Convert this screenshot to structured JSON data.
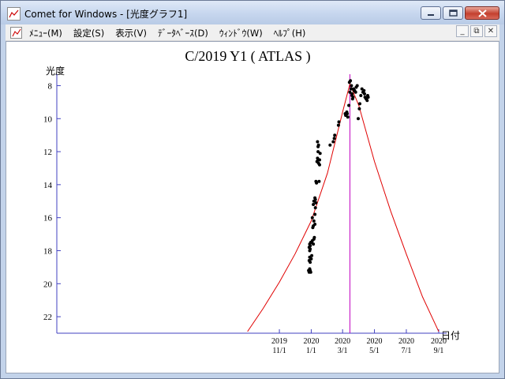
{
  "window": {
    "title": "Comet for Windows - [光度グラフ1]"
  },
  "menu": [
    {
      "label": "ﾒﾆｭｰ(M)"
    },
    {
      "label": "設定(S)"
    },
    {
      "label": "表示(V)"
    },
    {
      "label": "ﾃﾞｰﾀﾍﾞｰｽ(D)"
    },
    {
      "label": "ｳｨﾝﾄﾞｳ(W)"
    },
    {
      "label": "ﾍﾙﾌﾟ(H)"
    }
  ],
  "colors": {
    "curve": "#e00000",
    "marker": "#c000c0",
    "points": "#000000"
  },
  "chart_data": {
    "type": "scatter",
    "title": "C/2019 Y1 ( ATLAS )",
    "ylabel": "光度",
    "xlabel": "日付",
    "ylim": [
      23,
      7.5
    ],
    "yticks": [
      8,
      10,
      12,
      14,
      16,
      18,
      20,
      22
    ],
    "xlim": [
      "2018-09-01",
      "2020-09-01"
    ],
    "xticks": [
      {
        "date": "2019-11-01",
        "year": "2019",
        "md": "11/1"
      },
      {
        "date": "2020-01-01",
        "year": "2020",
        "md": "1/1"
      },
      {
        "date": "2020-03-01",
        "year": "2020",
        "md": "3/1"
      },
      {
        "date": "2020-05-01",
        "year": "2020",
        "md": "5/1"
      },
      {
        "date": "2020-07-01",
        "year": "2020",
        "md": "7/1"
      },
      {
        "date": "2020-09-01",
        "year": "2020",
        "md": "9/1"
      }
    ],
    "perihelion_date": "2020-03-15",
    "curve": {
      "type": "line",
      "x": [
        "2019-09-01",
        "2019-10-01",
        "2019-11-01",
        "2019-12-01",
        "2020-01-01",
        "2020-02-01",
        "2020-03-01",
        "2020-03-15",
        "2020-04-01",
        "2020-05-01",
        "2020-06-01",
        "2020-07-01",
        "2020-08-01",
        "2020-09-01"
      ],
      "y": [
        22.9,
        21.5,
        19.9,
        18.2,
        16.2,
        13.3,
        9.6,
        7.9,
        9.2,
        12.6,
        15.6,
        18.2,
        20.8,
        22.9
      ]
    },
    "series": [
      {
        "x": [
          "2019-12-27",
          "2019-12-28",
          "2019-12-29",
          "2019-12-30",
          "2019-12-31",
          "2019-12-28",
          "2019-12-29",
          "2019-12-30",
          "2020-01-01",
          "2020-01-02",
          "2019-12-28",
          "2019-12-29",
          "2019-12-30",
          "2020-01-02",
          "2020-01-03",
          "2019-12-29",
          "2019-12-30",
          "2019-12-31",
          "2020-01-05",
          "2020-01-06",
          "2020-01-07",
          "2020-01-08",
          "2020-01-04",
          "2020-01-05",
          "2020-01-06",
          "2020-01-08",
          "2020-01-09",
          "2020-01-10",
          "2020-01-03",
          "2020-01-05",
          "2020-01-06",
          "2020-01-08",
          "2020-01-09",
          "2020-01-10",
          "2020-01-11",
          "2020-01-12",
          "2020-01-13",
          "2020-01-14",
          "2020-01-15",
          "2020-01-13",
          "2020-01-14",
          "2020-01-15",
          "2020-01-14",
          "2020-01-16",
          "2020-01-16",
          "2020-01-17",
          "2020-01-17",
          "2020-01-18",
          "2020-02-06",
          "2020-02-12",
          "2020-02-14",
          "2020-02-15",
          "2020-02-22",
          "2020-02-23",
          "2020-03-06",
          "2020-03-07",
          "2020-03-09",
          "2020-03-10",
          "2020-03-11",
          "2020-03-13",
          "2020-03-15",
          "2020-03-17",
          "2020-03-19",
          "2020-03-21",
          "2020-03-23",
          "2020-03-27",
          "2020-03-29",
          "2020-03-14",
          "2020-03-16",
          "2020-03-18",
          "2020-03-19",
          "2020-03-20",
          "2020-03-22",
          "2020-03-24",
          "2020-03-26",
          "2020-03-31",
          "2020-04-02",
          "2020-04-03",
          "2020-04-05",
          "2020-04-07",
          "2020-04-09",
          "2020-04-11",
          "2020-04-12",
          "2020-04-13",
          "2020-04-15",
          "2020-04-17",
          "2020-04-18",
          "2020-04-19"
        ],
        "y": [
          19.2,
          19.3,
          19.1,
          19.2,
          19.3,
          18.6,
          18.4,
          18.7,
          18.5,
          18.3,
          17.8,
          17.6,
          17.9,
          17.5,
          17.4,
          18.0,
          17.7,
          17.5,
          17.6,
          17.3,
          17.2,
          16.4,
          16.6,
          16.5,
          16.2,
          15.8,
          15.4,
          15.1,
          16.0,
          15.2,
          15.0,
          14.8,
          14.9,
          13.8,
          13.9,
          12.6,
          12.4,
          12.5,
          12.7,
          11.4,
          11.7,
          11.6,
          12.0,
          12.5,
          13.8,
          12.5,
          12.8,
          12.1,
          11.6,
          11.4,
          11.2,
          11.0,
          10.4,
          10.2,
          9.7,
          9.8,
          9.6,
          9.7,
          9.9,
          9.2,
          8.4,
          8.2,
          8.6,
          8.7,
          8.3,
          8.1,
          8.0,
          7.8,
          7.7,
          8.0,
          8.5,
          8.8,
          8.2,
          8.3,
          8.4,
          10.0,
          9.4,
          9.1,
          8.6,
          8.2,
          8.4,
          8.3,
          8.5,
          8.7,
          8.8,
          8.9,
          8.6,
          8.7
        ]
      }
    ]
  }
}
